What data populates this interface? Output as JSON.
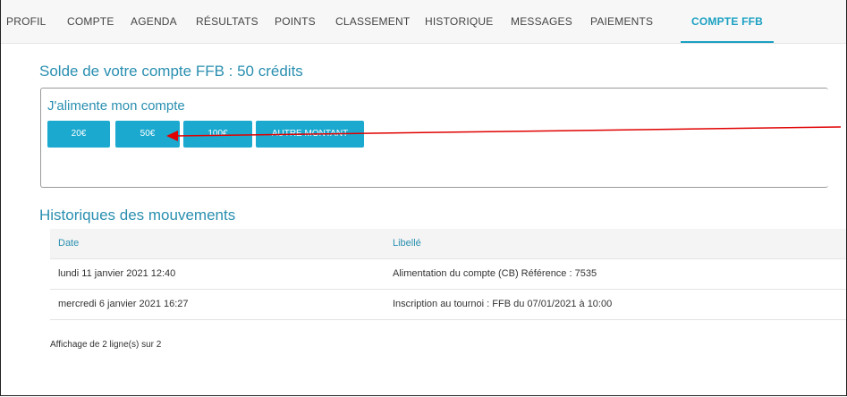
{
  "tabs": [
    {
      "label": "PROFIL"
    },
    {
      "label": "COMPTE"
    },
    {
      "label": "AGENDA"
    },
    {
      "label": "RÉSULTATS"
    },
    {
      "label": "POINTS"
    },
    {
      "label": "CLASSEMENT"
    },
    {
      "label": "HISTORIQUE"
    },
    {
      "label": "MESSAGES"
    },
    {
      "label": "PAIEMENTS"
    },
    {
      "label": "COMPTE FFB"
    }
  ],
  "active_tab": "COMPTE FFB",
  "account": {
    "balance_title": "Solde de votre compte FFB : 50 crédits"
  },
  "topup": {
    "title": "J'alimente mon compte",
    "buttons": [
      "20€",
      "50€",
      "100€",
      "AUTRE MONTANT"
    ]
  },
  "history": {
    "title": "Historiques des mouvements",
    "columns": [
      "Date",
      "Libellé"
    ],
    "rows": [
      {
        "date": "lundi 11 janvier 2021 12:40",
        "label": "Alimentation du compte (CB) Référence : 7535"
      },
      {
        "date": "mercredi 6 janvier 2021 16:27",
        "label": "Inscription au tournoi : FFB du 07/01/2021 à 10:00"
      }
    ],
    "footer": "Affichage de 2 ligne(s) sur 2"
  },
  "colors": {
    "accent": "#1ba0c2",
    "button": "#1ba9cf",
    "annotation_arrow": "#e00000"
  }
}
